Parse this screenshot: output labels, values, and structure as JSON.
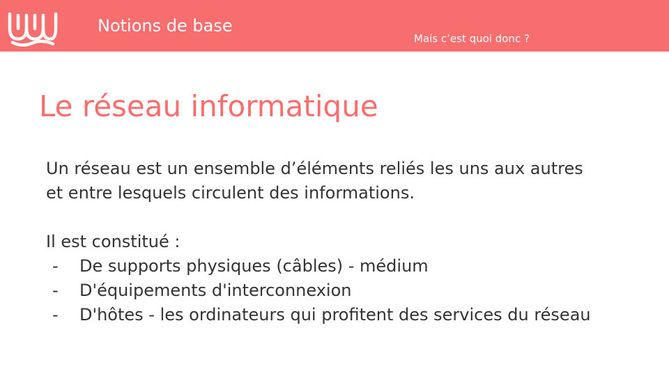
{
  "colors": {
    "accent": "#f86d6d",
    "text": "#333333",
    "background": "#ffffff"
  },
  "header": {
    "logo_icon": "wave-logo-icon",
    "section_title": "Notions de base",
    "subtitle": "Mais c’est quoi donc ?"
  },
  "slide": {
    "title": "Le réseau informatique",
    "paragraphs": [
      "Un réseau est un ensemble d’éléments reliés les uns aux autres",
      "et entre lesquels circulent des informations."
    ],
    "intro": "Il est constitué :",
    "bullet_marker": "-",
    "items": [
      "De supports physiques (câbles) - médium",
      "D'équipements d'interconnexion",
      "D'hôtes - les ordinateurs qui profitent des services du réseau"
    ]
  }
}
